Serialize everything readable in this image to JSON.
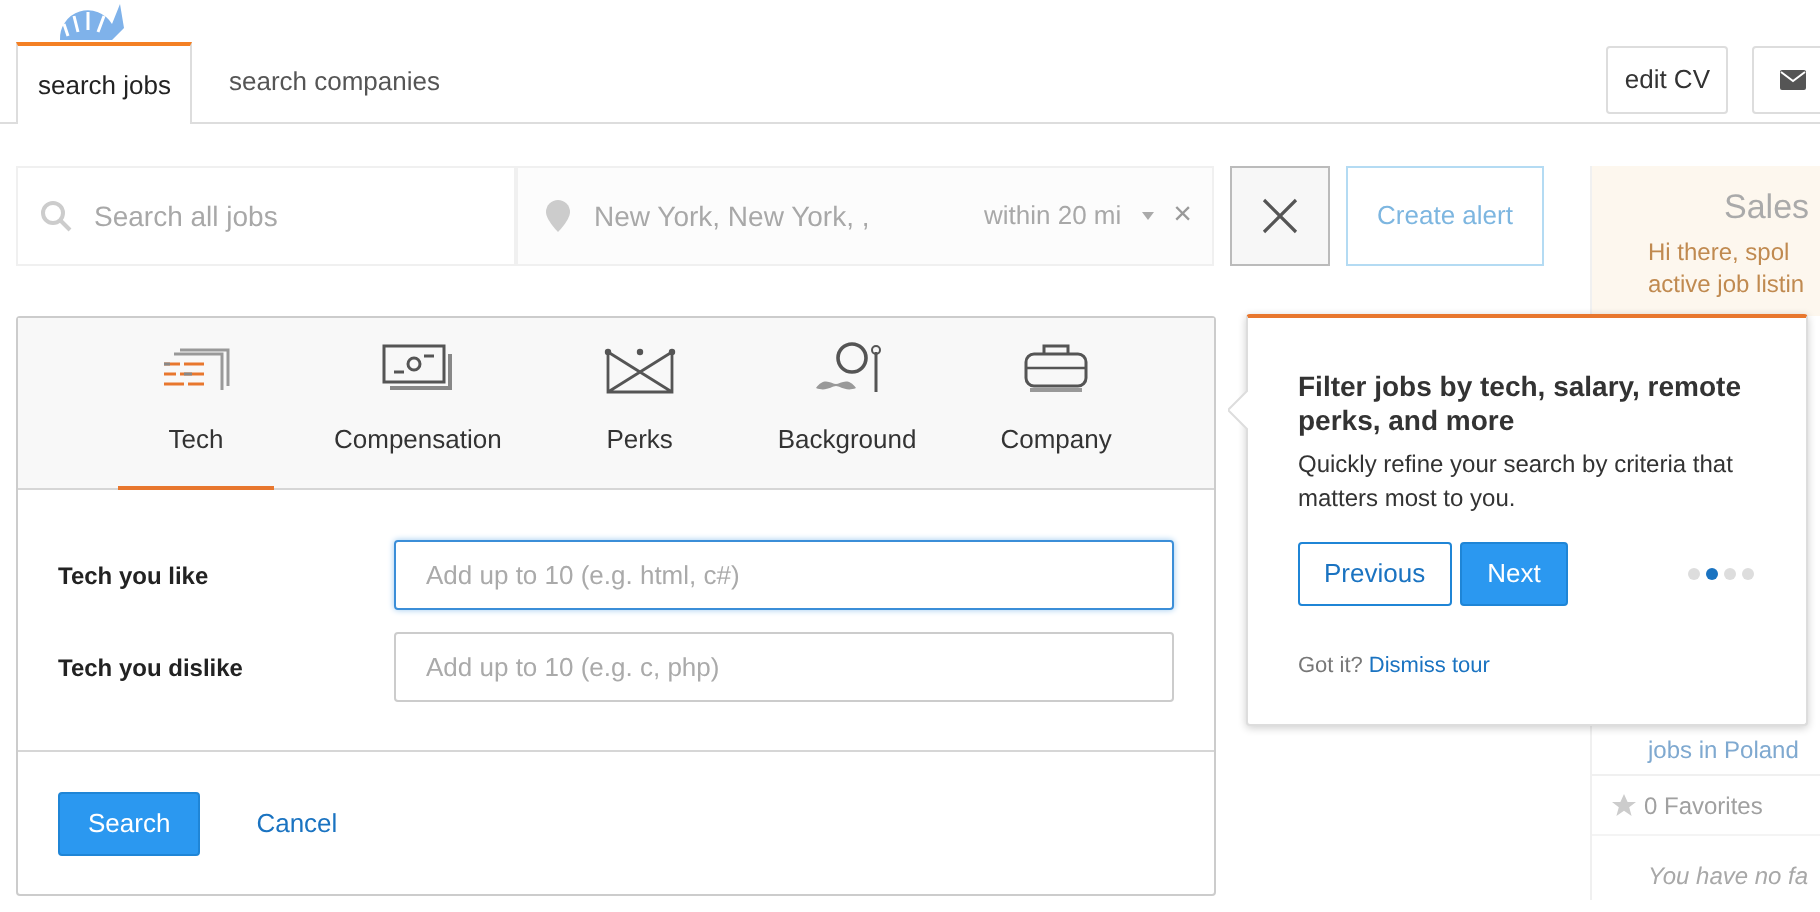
{
  "nav_tabs": [
    {
      "label": "search jobs",
      "selected": true
    },
    {
      "label": "search companies",
      "selected": false
    }
  ],
  "header_buttons": [
    {
      "kind": "text",
      "label": "edit CV"
    },
    {
      "kind": "mail"
    }
  ],
  "search_bar": {
    "keyword": {
      "placeholder": "Search all jobs"
    },
    "location": {
      "value": "New York, New York, ,",
      "radius": "within 20 mi",
      "clear": "×"
    },
    "create_alert": "Create alert"
  },
  "filter_panel": {
    "tabs": [
      {
        "kind": "tech",
        "label": "Tech",
        "selected": true
      },
      {
        "kind": "compensation",
        "label": "Compensation",
        "selected": false
      },
      {
        "kind": "perks",
        "label": "Perks",
        "selected": false
      },
      {
        "kind": "background",
        "label": "Background",
        "selected": false
      },
      {
        "kind": "company",
        "label": "Company",
        "selected": false
      }
    ],
    "fields": [
      {
        "label": "Tech you like",
        "placeholder": "Add up to 10 (e.g. html, c#)",
        "focused": true
      },
      {
        "label": "Tech you dislike",
        "placeholder": "Add up to 10 (e.g. c, php)",
        "focused": false
      }
    ],
    "buttons": [
      {
        "kind": "primary",
        "label": "Search"
      },
      {
        "kind": "link",
        "label": "Cancel"
      }
    ]
  },
  "tour": {
    "title": "Filter jobs by tech, salary, remote perks, and more",
    "body": "Quickly refine your search by criteria that matters most to you.",
    "buttons": [
      {
        "kind": "outline",
        "label": "Previous"
      },
      {
        "kind": "primary",
        "label": "Next"
      }
    ],
    "steps": [
      {
        "selected": false
      },
      {
        "selected": true
      },
      {
        "selected": false
      },
      {
        "selected": false
      }
    ],
    "footer_text": "Got it?",
    "dismiss_link": "Dismiss tour"
  },
  "sidebar": {
    "title": "Sales",
    "lines": [
      "Hi there, spol",
      "active job listin"
    ],
    "link": "jobs in Poland",
    "favorites": "0 Favorites",
    "empty_note": "You have no fa"
  }
}
